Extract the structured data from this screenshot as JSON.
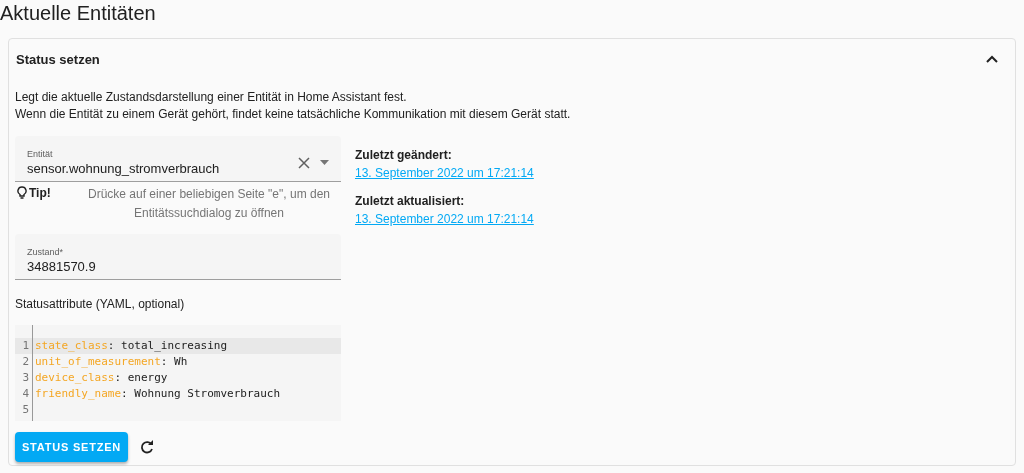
{
  "page_title": "Aktuelle Entitäten",
  "card": {
    "title": "Status setzen",
    "expanded": true,
    "description": [
      "Legt die aktuelle Zustandsdarstellung einer Entität in Home Assistant fest.",
      "Wenn die Entität zu einem Gerät gehört, findet keine tatsächliche Kommunikation mit diesem Gerät statt."
    ],
    "entity_field": {
      "label": "Entität",
      "value": "sensor.wohnung_stromverbrauch"
    },
    "tip": {
      "label": "Tip!",
      "text": "Drücke auf einer beliebigen Seite \"e\", um den Entitätssuchdialog zu öffnen"
    },
    "state_field": {
      "label": "Zustand*",
      "value": "34881570.9"
    },
    "attributes_label": "Statusattribute (YAML, optional)",
    "code_lines": [
      {
        "number": "1",
        "key": "state_class",
        "separator": ":",
        "value": "total_increasing",
        "active": true
      },
      {
        "number": "2",
        "key": "unit_of_measurement",
        "separator": ":",
        "value": "Wh",
        "active": false
      },
      {
        "number": "3",
        "key": "device_class",
        "separator": ":",
        "value": "energy",
        "active": false
      },
      {
        "number": "4",
        "key": "friendly_name",
        "separator": ":",
        "value": "Wohnung Stromverbrauch",
        "active": false
      },
      {
        "number": "5",
        "active": false
      }
    ],
    "info": [
      {
        "label": "Zuletzt geändert:",
        "link": "13. September 2022 um 17:21:14"
      },
      {
        "label": "Zuletzt aktualisiert:",
        "link": "13. September 2022 um 17:21:14"
      }
    ],
    "submit_button": "STATUS SETZEN"
  }
}
